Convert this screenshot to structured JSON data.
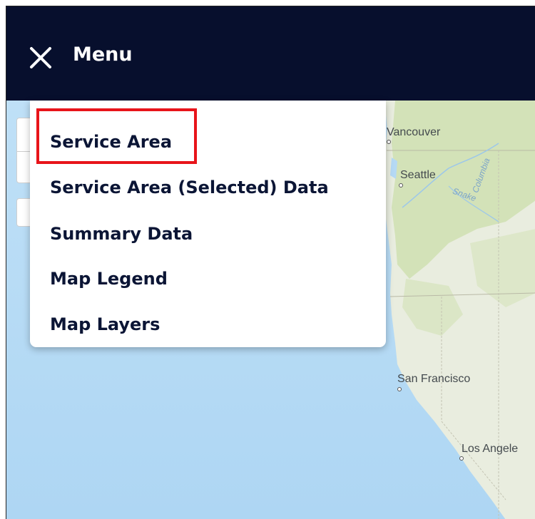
{
  "header": {
    "title": "Menu",
    "close_icon": "close-icon"
  },
  "menu": {
    "items": [
      {
        "label": "Service Area",
        "highlighted": true
      },
      {
        "label": "Service Area (Selected) Data"
      },
      {
        "label": "Summary Data"
      },
      {
        "label": "Map Legend"
      },
      {
        "label": "Map Layers"
      }
    ]
  },
  "map": {
    "cities": [
      "Vancouver",
      "Seattle",
      "San Francisco",
      "Los Angele"
    ],
    "rivers": [
      "Columbia",
      "Snake"
    ],
    "colors": {
      "ocean": "#b5d9f4",
      "land": "#e9eddf",
      "forest": "#d3e2b8",
      "header": "#070f2d",
      "highlight": "#e8141a"
    }
  }
}
